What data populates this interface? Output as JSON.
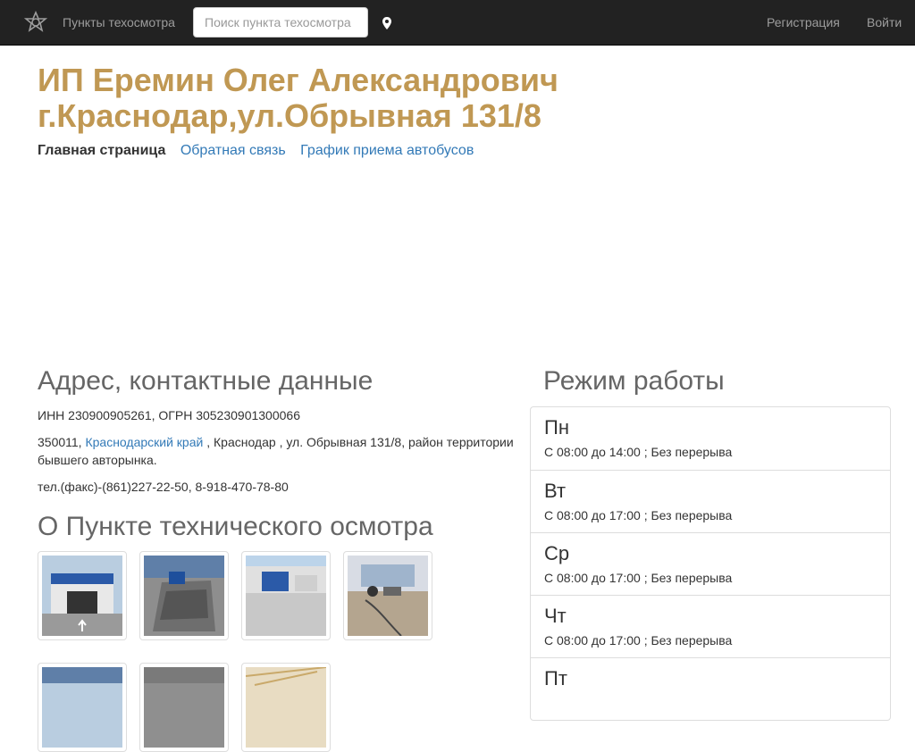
{
  "navbar": {
    "brand": "Пункты техосмотра",
    "search_placeholder": "Поиск пункта техосмотра",
    "register": "Регистрация",
    "login": "Войти"
  },
  "page": {
    "title_line1": "ИП Еремин Олег Александрович",
    "title_line2": "г.Краснодар,ул.Обрывная 131/8"
  },
  "subnav": {
    "home": "Главная страница",
    "feedback": "Обратная связь",
    "bus_schedule": "График приема автобусов"
  },
  "contacts": {
    "heading": "Адрес, контактные данные",
    "inn": "ИНН 230900905261, ОГРН 305230901300066",
    "postcode": "350011,",
    "region_link": "Краснодарский край",
    "address_rest": ", Краснодар , ул. Обрывная 131/8, район территории бывшего авторынка.",
    "phone": "тел.(факс)-(861)227-22-50, 8-918-470-78-80"
  },
  "about": {
    "heading": "О Пункте технического осмотра",
    "photos": [
      {
        "name": "building-photo"
      },
      {
        "name": "inspection-pit-photo"
      },
      {
        "name": "yard-photo"
      },
      {
        "name": "equipment-photo"
      },
      {
        "name": "photo-5"
      },
      {
        "name": "photo-6"
      },
      {
        "name": "photo-7"
      }
    ]
  },
  "schedule": {
    "heading": "Режим работы",
    "days": [
      {
        "day": "Пн",
        "hours": "С 08:00 до 14:00 ; Без перерыва"
      },
      {
        "day": "Вт",
        "hours": "С 08:00 до 17:00 ; Без перерыва"
      },
      {
        "day": "Ср",
        "hours": "С 08:00 до 17:00 ; Без перерыва"
      },
      {
        "day": "Чт",
        "hours": "С 08:00 до 17:00 ; Без перерыва"
      },
      {
        "day": "Пт",
        "hours": ""
      }
    ]
  },
  "colors": {
    "navbar_bg": "#222222",
    "title": "#c09853",
    "link": "#337ab7"
  }
}
